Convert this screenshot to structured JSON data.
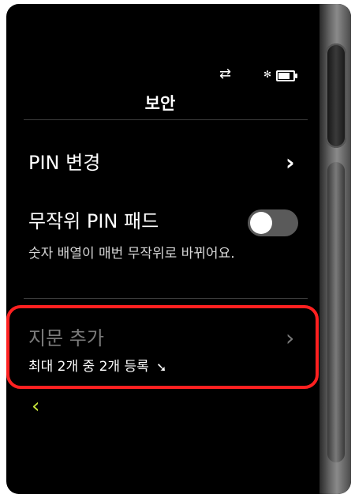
{
  "status_bar": {
    "transfer_icon": "transfer-arrows-icon",
    "bluetooth_icon": "bluetooth-icon",
    "battery_icon": "battery-icon",
    "battery_level": 0.85
  },
  "header": {
    "title": "보안"
  },
  "settings": {
    "change_pin": {
      "label": "PIN 변경",
      "chevron_icon": "chevron-right-icon"
    },
    "random_pin_pad": {
      "label": "무작위 PIN 패드",
      "description": "숫자 배열이 매번 무작위로 바뀌어요.",
      "enabled": false
    },
    "add_fingerprint": {
      "label": "지문 추가",
      "description": "최대 2개 중 2개 등록",
      "disabled": true,
      "chevron_icon": "chevron-right-icon"
    }
  },
  "nav": {
    "back_icon": "chevron-left-icon"
  },
  "colors": {
    "background": "#000000",
    "accent_back": "#c8e63a",
    "highlight": "#ff2020",
    "toggle_off": "#5a5a5a"
  }
}
